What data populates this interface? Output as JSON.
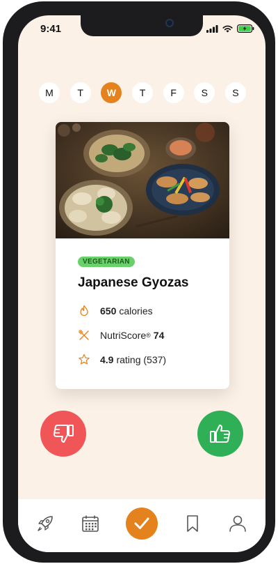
{
  "status_bar": {
    "time": "9:41",
    "icons": [
      "signal-icon",
      "wifi-icon",
      "battery-icon"
    ]
  },
  "week": {
    "days": [
      "M",
      "T",
      "W",
      "T",
      "F",
      "S",
      "S"
    ],
    "selected_index": 2
  },
  "recipe": {
    "badge": "VEGETARIAN",
    "title": "Japanese Gyozas",
    "calories_value": "650",
    "calories_unit": "calories",
    "nutri_label": "NutriScore",
    "nutri_symbol": "®",
    "nutri_value": "74",
    "rating_value": "4.9",
    "rating_text": "rating (537)"
  },
  "actions": {
    "dislike_icon": "thumbs-down-icon",
    "like_icon": "thumbs-up-icon"
  },
  "nav": {
    "items": [
      "rocket-icon",
      "calendar-icon",
      "checkmark-icon",
      "bookmark-icon",
      "profile-icon"
    ],
    "active_index": 2
  },
  "colors": {
    "accent": "#e4821e",
    "background": "#fbf1e6",
    "dislike": "#f05557",
    "like": "#2fb057",
    "badge": "#6ad06a"
  }
}
